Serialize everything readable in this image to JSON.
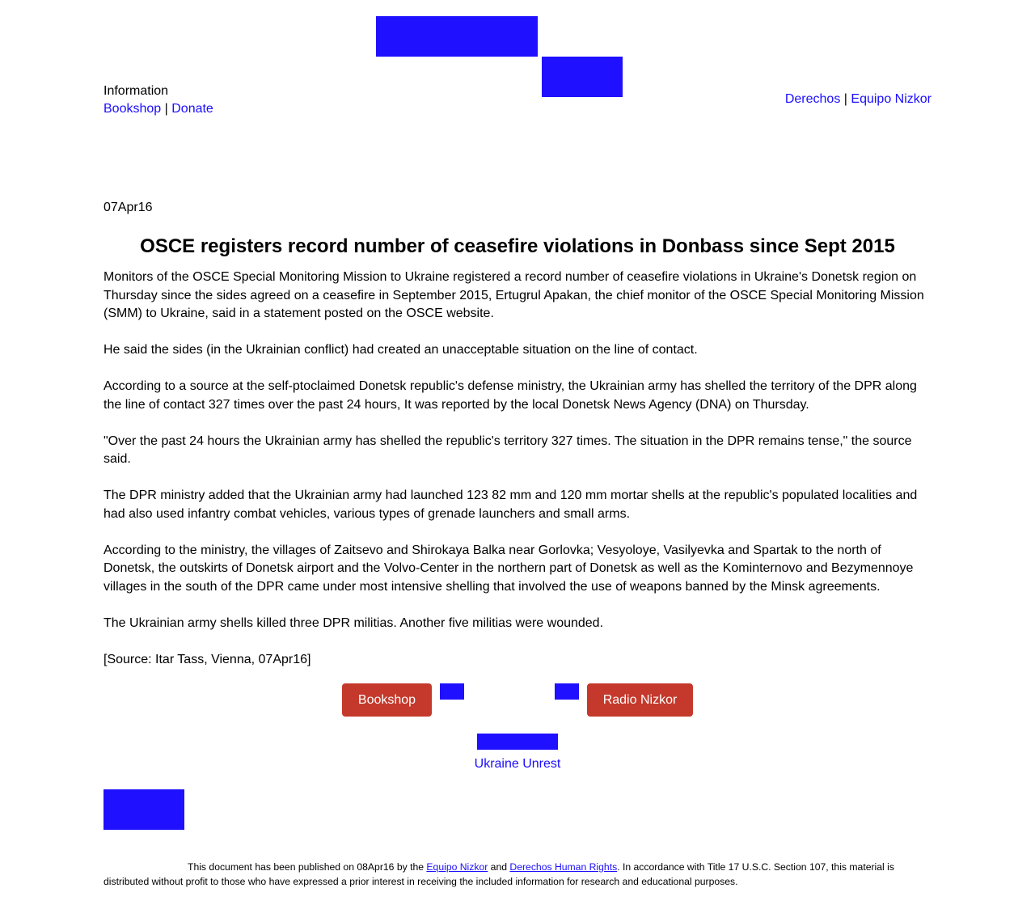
{
  "header": {
    "left_label": "Information",
    "links_left": [
      "Bookshop",
      "Donate"
    ],
    "links_right": [
      "Derechos",
      "Equipo Nizkor"
    ],
    "separator": "|"
  },
  "article": {
    "date": "07Apr16",
    "title": "OSCE registers record number of ceasefire violations in Donbass since Sept 2015",
    "paragraphs": [
      "Monitors of the OSCE Special Monitoring Mission to Ukraine registered a record number of ceasefire violations in Ukraine's Donetsk region on Thursday since the sides agreed on a ceasefire in September 2015, Ertugrul Apakan, the chief monitor of the OSCE Special Monitoring Mission (SMM) to Ukraine, said in a statement posted on the OSCE website.",
      "He said the sides (in the Ukrainian conflict) had created an unacceptable situation on the line of contact.",
      "According to a source at the self-ptoclaimed Donetsk republic's defense ministry, the Ukrainian army has shelled the territory of the DPR along the line of contact 327 times over the past 24 hours, It was reported by the local Donetsk News Agency (DNA) on Thursday.",
      "\"Over the past 24 hours the Ukrainian army has shelled the republic's territory 327 times. The situation in the DPR remains tense,\" the source said.",
      "The DPR ministry added that the Ukrainian army had launched 123 82 mm and 120 mm mortar shells at the republic's populated localities and had also used infantry combat vehicles, various types of grenade launchers and small arms.",
      "According to the ministry, the villages of Zaitsevo and Shirokaya Balka near Gorlovka; Vesyoloye, Vasilyevka and Spartak to the north of Donetsk, the outskirts of Donetsk airport and the Volvo-Center in the northern part of Donetsk as well as the Kominternovo and Bezymennoye villages in the south of the DPR came under most intensive shelling that involved the use of weapons banned by the Minsk agreements.",
      "The Ukrainian army shells killed three DPR militias. Another five militias were wounded.",
      "[Source: Itar Tass, Vienna, 07Apr16]"
    ]
  },
  "nav_buttons": {
    "bookshop": "Bookshop",
    "radio": "Radio Nizkor"
  },
  "related_link": "Ukraine Unrest",
  "footer": {
    "text_1": "This document has been published on 08Apr16 by the ",
    "link_1": "Equipo Nizkor",
    "text_2": " and ",
    "link_2": "Derechos Human Rights",
    "text_3": ". In accordance with Title 17 U.S.C. Section 107, this material is distributed without profit to those who have expressed a prior interest in receiving the included information for research and educational purposes."
  },
  "colors": {
    "link": "#1a0dff",
    "placeholder_image": "#1f10ff",
    "button_bg": "#c4392b",
    "button_text": "#ffffff"
  }
}
